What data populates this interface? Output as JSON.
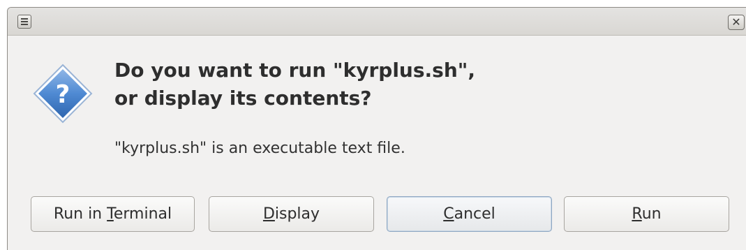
{
  "titlebar": {
    "menu_icon": "window-menu-icon",
    "close_symbol": "✕"
  },
  "dialog": {
    "icon": "question-icon",
    "icon_glyph": "?",
    "heading_line1": "Do you want to run \"kyrplus.sh\",",
    "heading_line2": "or display its contents?",
    "message": "\"kyrplus.sh\" is an executable text file."
  },
  "buttons": {
    "run_in_terminal": {
      "pre": "Run in ",
      "mnemonic": "T",
      "post": "erminal"
    },
    "display": {
      "pre": "",
      "mnemonic": "D",
      "post": "isplay"
    },
    "cancel": {
      "pre": "",
      "mnemonic": "C",
      "post": "ancel",
      "focused": true
    },
    "run": {
      "pre": "",
      "mnemonic": "R",
      "post": "un"
    }
  },
  "colors": {
    "window_bg": "#f2f1f0",
    "icon_blue": "#3d7bc8",
    "focus_border": "#8ea7c2"
  }
}
